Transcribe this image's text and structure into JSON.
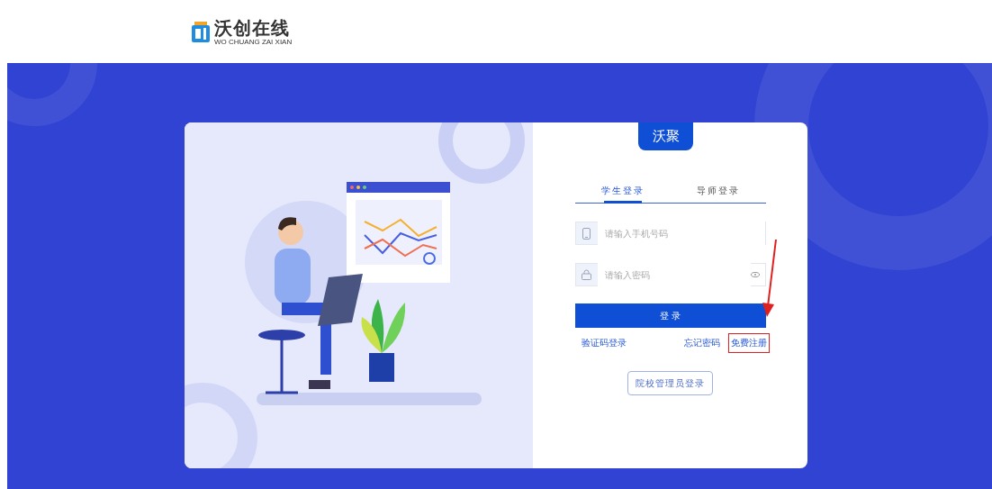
{
  "logo": {
    "title": "沃创在线",
    "subtitle": "WO CHUANG ZAI XIAN"
  },
  "card": {
    "badge": "沃聚",
    "tabs": [
      {
        "label": "学生登录",
        "selected": true
      },
      {
        "label": "导师登录",
        "selected": false
      }
    ],
    "fields": [
      {
        "kind": "phone",
        "placeholder": "请输入手机号码"
      },
      {
        "kind": "password",
        "placeholder": "请输入密码"
      }
    ],
    "submit": "登 录",
    "links": [
      {
        "label": "验证码登录",
        "highlighted": false
      },
      {
        "label": "忘记密码",
        "highlighted": false
      },
      {
        "label": "免费注册",
        "highlighted": true
      }
    ],
    "admin_button": "院校管理员登录"
  }
}
